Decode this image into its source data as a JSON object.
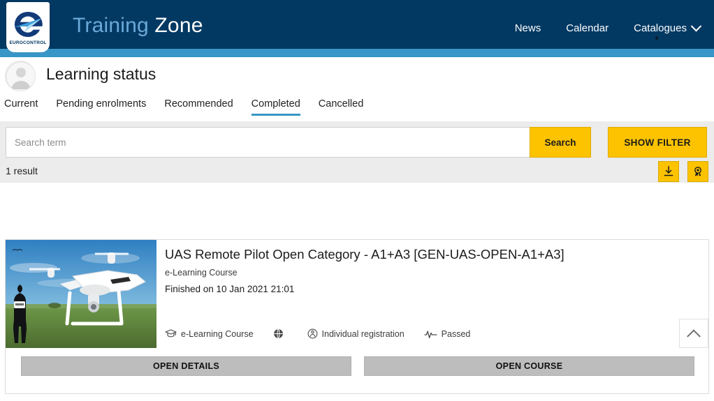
{
  "header": {
    "logo_alt": "EUROCONTROL",
    "brand_part1": "Training ",
    "brand_part2": "Zone",
    "nav": [
      {
        "label": "News",
        "has_caret": false
      },
      {
        "label": "Calendar",
        "has_caret": false
      },
      {
        "label": "Catalogues",
        "has_caret": true
      }
    ],
    "colors": {
      "bar": "#023963",
      "stripe": "#3796c7",
      "brand_light": "#6aa9d8"
    }
  },
  "status": {
    "page_title": "Learning status",
    "tabs": [
      {
        "label": "Current",
        "active": false
      },
      {
        "label": "Pending enrolments",
        "active": false
      },
      {
        "label": "Recommended",
        "active": false
      },
      {
        "label": "Completed",
        "active": true
      },
      {
        "label": "Cancelled",
        "active": false
      }
    ],
    "active_tab_color": "#3796c7"
  },
  "search": {
    "placeholder": "Search term",
    "value": "",
    "search_label": "Search",
    "filter_label": "SHOW FILTER",
    "accent": "#fdc300"
  },
  "results": {
    "count_label": "1 result",
    "download_icon": "download-icon",
    "certificate_icon": "award-icon"
  },
  "course": {
    "title": "UAS Remote Pilot Open Category - A1+A3 [GEN-UAS-OPEN-A1+A3]",
    "subtitle": "e-Learning Course",
    "finished": "Finished on 10 Jan 2021 21:01",
    "meta": [
      {
        "icon": "graduation-cap-icon",
        "label": "e-Learning Course"
      },
      {
        "icon": "globe-icon",
        "label": ""
      },
      {
        "icon": "individual-registration-icon",
        "label": "Individual registration"
      },
      {
        "icon": "activity-pulse-icon",
        "label": "Passed"
      }
    ],
    "actions": [
      {
        "label": "OPEN DETAILS"
      },
      {
        "label": "OPEN COURSE"
      }
    ],
    "collapse_icon": "chevron-up-icon",
    "thumbnail_alt": "drone-photo"
  }
}
